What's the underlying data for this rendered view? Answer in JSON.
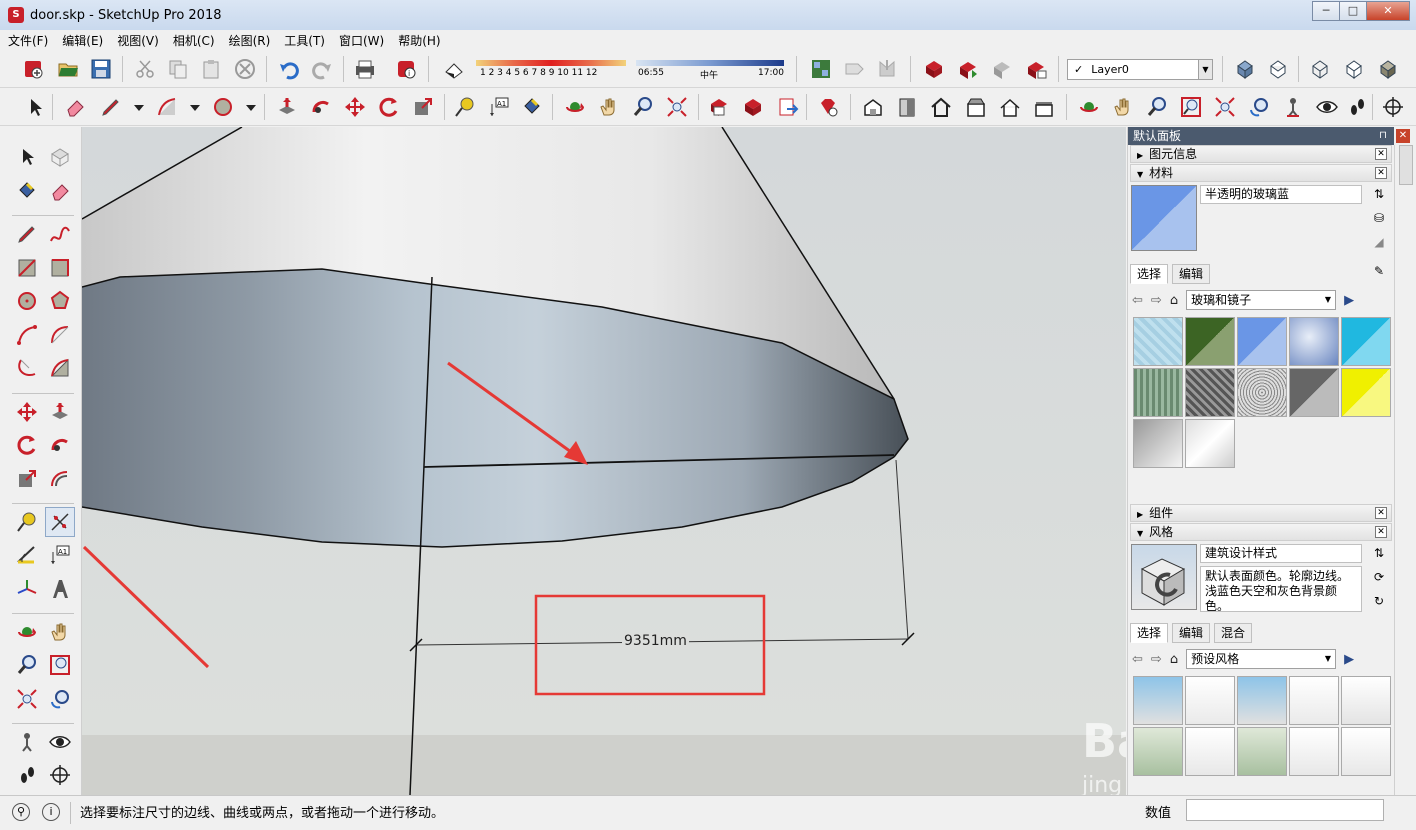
{
  "window": {
    "title": "door.skp - SketchUp Pro 2018",
    "app_icon": "sketchup-icon",
    "minimize": "─",
    "maximize": "□",
    "close": "✕"
  },
  "menu": [
    "文件(F)",
    "编辑(E)",
    "视图(V)",
    "相机(C)",
    "绘图(R)",
    "工具(T)",
    "窗口(W)",
    "帮助(H)"
  ],
  "shadow_settings": {
    "months": "1 2 3 4 5 6 7 8 9 10 11 12",
    "time_start": "06:55",
    "time_mid": "中午",
    "time_end": "17:00"
  },
  "layer": {
    "check": "✓",
    "name": "Layer0"
  },
  "viewport": {
    "dimension_label": "9351mm",
    "highlight_color": "#e53935",
    "arrow_color": "#e53935"
  },
  "tray": {
    "title": "默认面板",
    "pin": "⊓",
    "close": "✕",
    "entity_info": {
      "title": "图元信息"
    },
    "materials": {
      "title": "材料",
      "current_name": "半透明的玻璃蓝",
      "tab_select": "选择",
      "tab_edit": "编辑",
      "library": "玻璃和镜子"
    },
    "components": {
      "title": "组件"
    },
    "styles": {
      "title": "风格",
      "current_name": "建筑设计样式",
      "description": "默认表面颜色。轮廓边线。浅蓝色天空和灰色背景颜色。",
      "tab_select": "选择",
      "tab_edit": "编辑",
      "tab_mix": "混合",
      "library": "预设风格"
    }
  },
  "status": {
    "prompt": "选择要标注尺寸的边线、曲线或两点，或者拖动一个进行移动。",
    "vcb_label": "数值",
    "info_icon": "i",
    "geo_icon": "⚲"
  },
  "colors": {
    "tray_header": "#4b5a6e",
    "glass_blue": "#6a96e6",
    "sketchup_red": "#c8202a"
  }
}
